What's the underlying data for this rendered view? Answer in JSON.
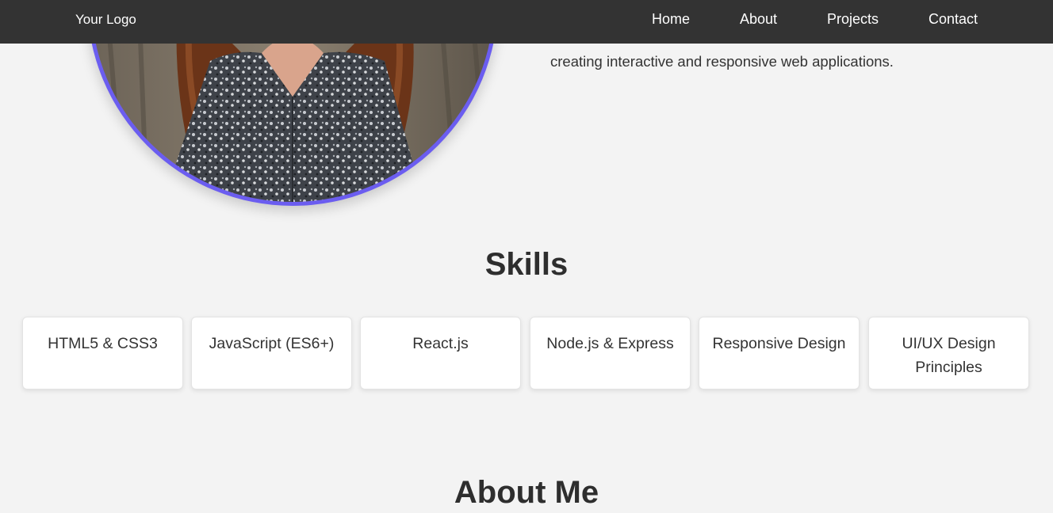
{
  "header": {
    "logo": "Your Logo",
    "nav": {
      "home": "Home",
      "about": "About",
      "projects": "Projects",
      "contact": "Contact"
    }
  },
  "hero": {
    "intro_line2": "creating interactive and responsive web applications."
  },
  "skills": {
    "title": "Skills",
    "items": [
      "HTML5 & CSS3",
      "JavaScript (ES6+)",
      "React.js",
      "Node.js & Express",
      "Responsive Design",
      "UI/UX Design Principles"
    ]
  },
  "about": {
    "title": "About Me"
  },
  "colors": {
    "navbar": "#333333",
    "page_background": "#f3f3f3",
    "accent_ring": "#6b5df0",
    "card_background": "#ffffff"
  }
}
